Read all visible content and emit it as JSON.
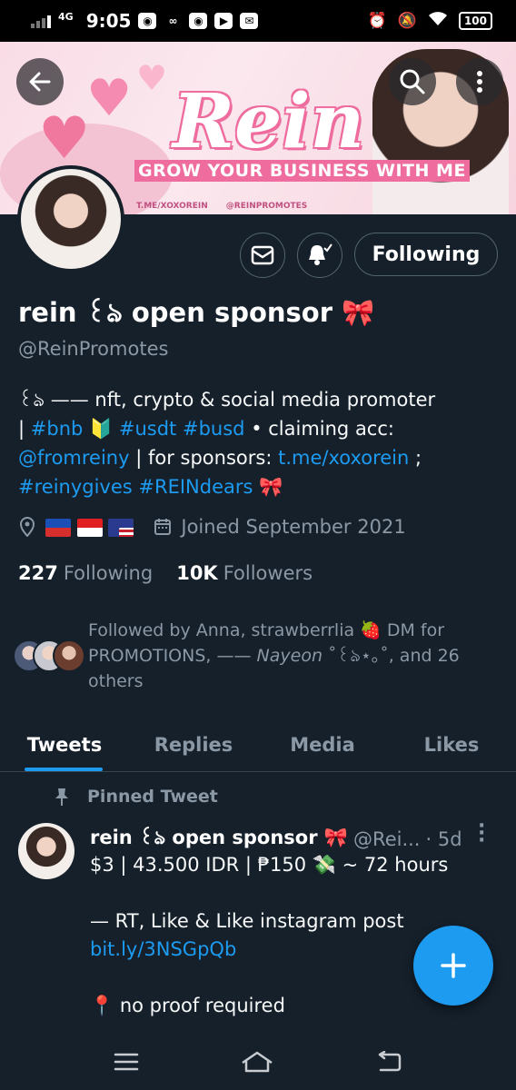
{
  "status_bar": {
    "network": "4G",
    "time": "9:05",
    "battery": "100"
  },
  "banner": {
    "title": "Rein",
    "tagline": "GROW YOUR BUSINESS WITH ME",
    "telegram": "T.ME/XOXOREIN",
    "twitter": "@REINPROMOTES"
  },
  "actions": {
    "following_label": "Following"
  },
  "profile": {
    "name": "rein ꒰ঌ open sponsor 🎀",
    "handle": "@ReinPromotes",
    "bio": {
      "line1": "꒰ঌ —— nft, crypto & social media promoter",
      "line2_pre": "| ",
      "tag_bnb": "#bnb",
      "line2_emoji": "🔰",
      "tag_usdt": "#usdt",
      "tag_busd": "#busd",
      "line2_post": "• claiming acc:",
      "mention": "@fromreiny",
      "line3_mid": "| for sponsors:",
      "link": "t.me/xoxorein",
      "line3_post": ";",
      "tag_reinygives": "#reinygives",
      "tag_reindears": "#REINdears",
      "line4_emoji": "🎀"
    },
    "location_flags": [
      "Philippines",
      "Indonesia",
      "United States"
    ],
    "joined": "Joined September 2021",
    "following_count": "227",
    "following_label": "Following",
    "followers_count": "10K",
    "followers_label": "Followers",
    "followed_by_pre": "Followed by Anna, strawberrlia 🍓 DM for PROMOTIONS, ——",
    "followed_by_italic": "Nayeon",
    "followed_by_post": "˚꒰ঌ⋆｡˚, and 26 others"
  },
  "tabs": [
    {
      "label": "Tweets"
    },
    {
      "label": "Replies"
    },
    {
      "label": "Media"
    },
    {
      "label": "Likes"
    }
  ],
  "tweet": {
    "pinned_label": "Pinned Tweet",
    "name": "rein ꒰ঌ open sponsor 🎀",
    "handle": "@Rei...",
    "time": "· 5d",
    "line1": "$3 | 43.500 IDR | ₱150  💸 ~ 72 hours",
    "line2": "— RT, Like & Like instagram post",
    "link": "bit.ly/3NSGpQb",
    "line3": "📍 no proof required"
  },
  "colors": {
    "background": "#15202b",
    "accent": "#1d9bf0",
    "secondary_text": "#8b98a5",
    "border": "#536471"
  }
}
